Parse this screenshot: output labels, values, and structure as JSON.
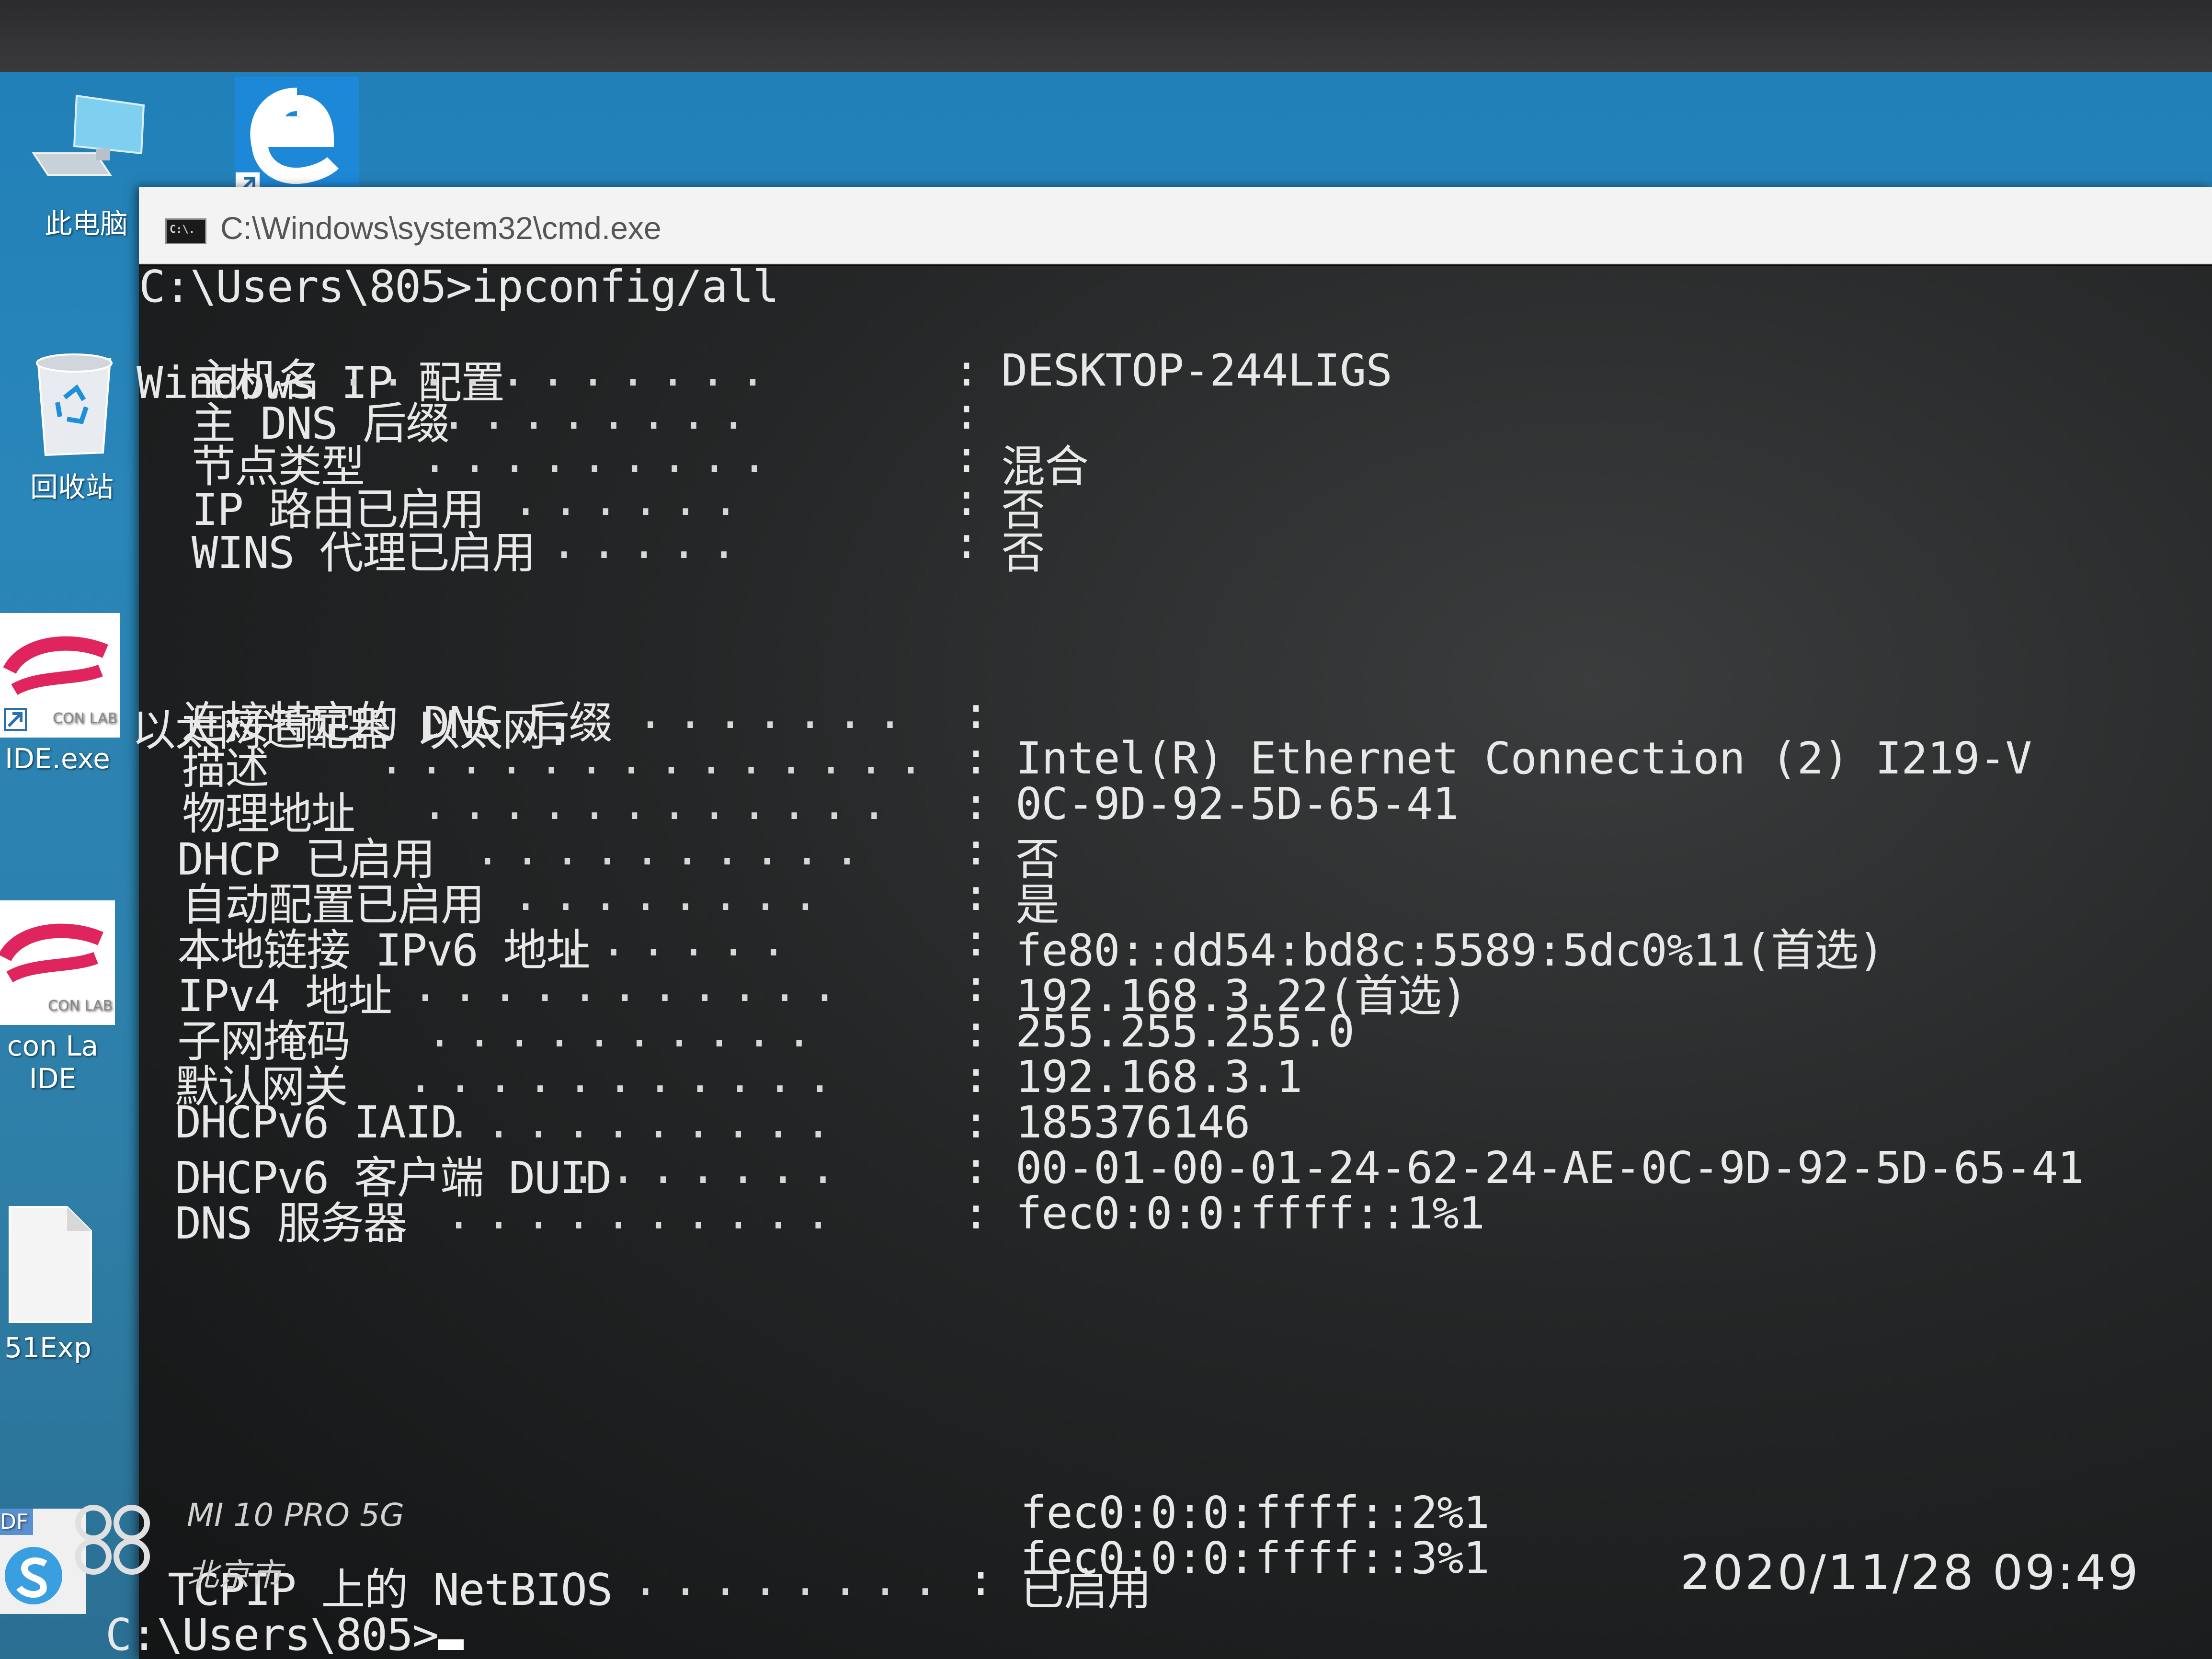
{
  "desktop": {
    "icons": [
      {
        "name": "this-pc",
        "label": "此电脑"
      },
      {
        "name": "recycle-bin",
        "label": "回收站"
      },
      {
        "name": "ide-exe",
        "label": "IDE.exe"
      },
      {
        "name": "silicon-labs-ide",
        "label": "con La\nIDE"
      },
      {
        "name": "c51-explorer",
        "label": "51Exp"
      },
      {
        "name": "pdf-shortcut",
        "label": "DF"
      }
    ]
  },
  "window": {
    "title": "C:\\Windows\\system32\\cmd.exe",
    "icon_text": "C:\\."
  },
  "console": {
    "prompt_command": "C:\\Users\\805>ipconfig/all",
    "windows_ip_header": "Windows IP 配置",
    "host_section": [
      {
        "label": "主机名",
        "value": "DESKTOP-244LIGS"
      },
      {
        "label": "主 DNS 后缀",
        "value": ""
      },
      {
        "label": "节点类型",
        "value": "混合"
      },
      {
        "label": "IP 路由已启用",
        "value": "否"
      },
      {
        "label": "WINS 代理已启用",
        "value": "否"
      }
    ],
    "adapter_header": "以太网适配器 以太网:",
    "adapter_section": [
      {
        "label": "连接特定的 DNS 后缀",
        "value": ""
      },
      {
        "label": "描述",
        "value": "Intel(R) Ethernet Connection (2) I219-V"
      },
      {
        "label": "物理地址",
        "value": "0C-9D-92-5D-65-41"
      },
      {
        "label": "DHCP 已启用",
        "value": "否"
      },
      {
        "label": "自动配置已启用",
        "value": "是"
      },
      {
        "label": "本地链接 IPv6 地址",
        "value": "fe80::dd54:bd8c:5589:5dc0%11(首选)"
      },
      {
        "label": "IPv4 地址",
        "value": "192.168.3.22(首选)"
      },
      {
        "label": "子网掩码",
        "value": "255.255.255.0"
      },
      {
        "label": "默认网关",
        "value": "192.168.3.1"
      },
      {
        "label": "DHCPv6 IAID",
        "value": "185376146"
      },
      {
        "label": "DHCPv6 客户端 DUID",
        "value": "00-01-00-01-24-62-24-AE-0C-9D-92-5D-65-41"
      },
      {
        "label": "DNS 服务器",
        "value": "fec0:0:0:ffff::1%1"
      }
    ],
    "dns_extra": [
      "fec0:0:0:ffff::2%1",
      "fec0:0:0:ffff::3%1"
    ],
    "netbios": {
      "label": "TCPIP 上的 NetBIOS",
      "value": "已启用"
    },
    "final_prompt": "C:\\Users\\805>"
  },
  "overlay": {
    "watermark_model": "MI 10 PRO 5G",
    "watermark_location": "北京市",
    "timestamp": "2020/11/28 09:49"
  },
  "colors": {
    "desktop_blue": "#2a86b9",
    "console_bg": "#1c1e1f",
    "console_text": "#e8e8e8",
    "titlebar_bg": "#f3f3f3"
  }
}
